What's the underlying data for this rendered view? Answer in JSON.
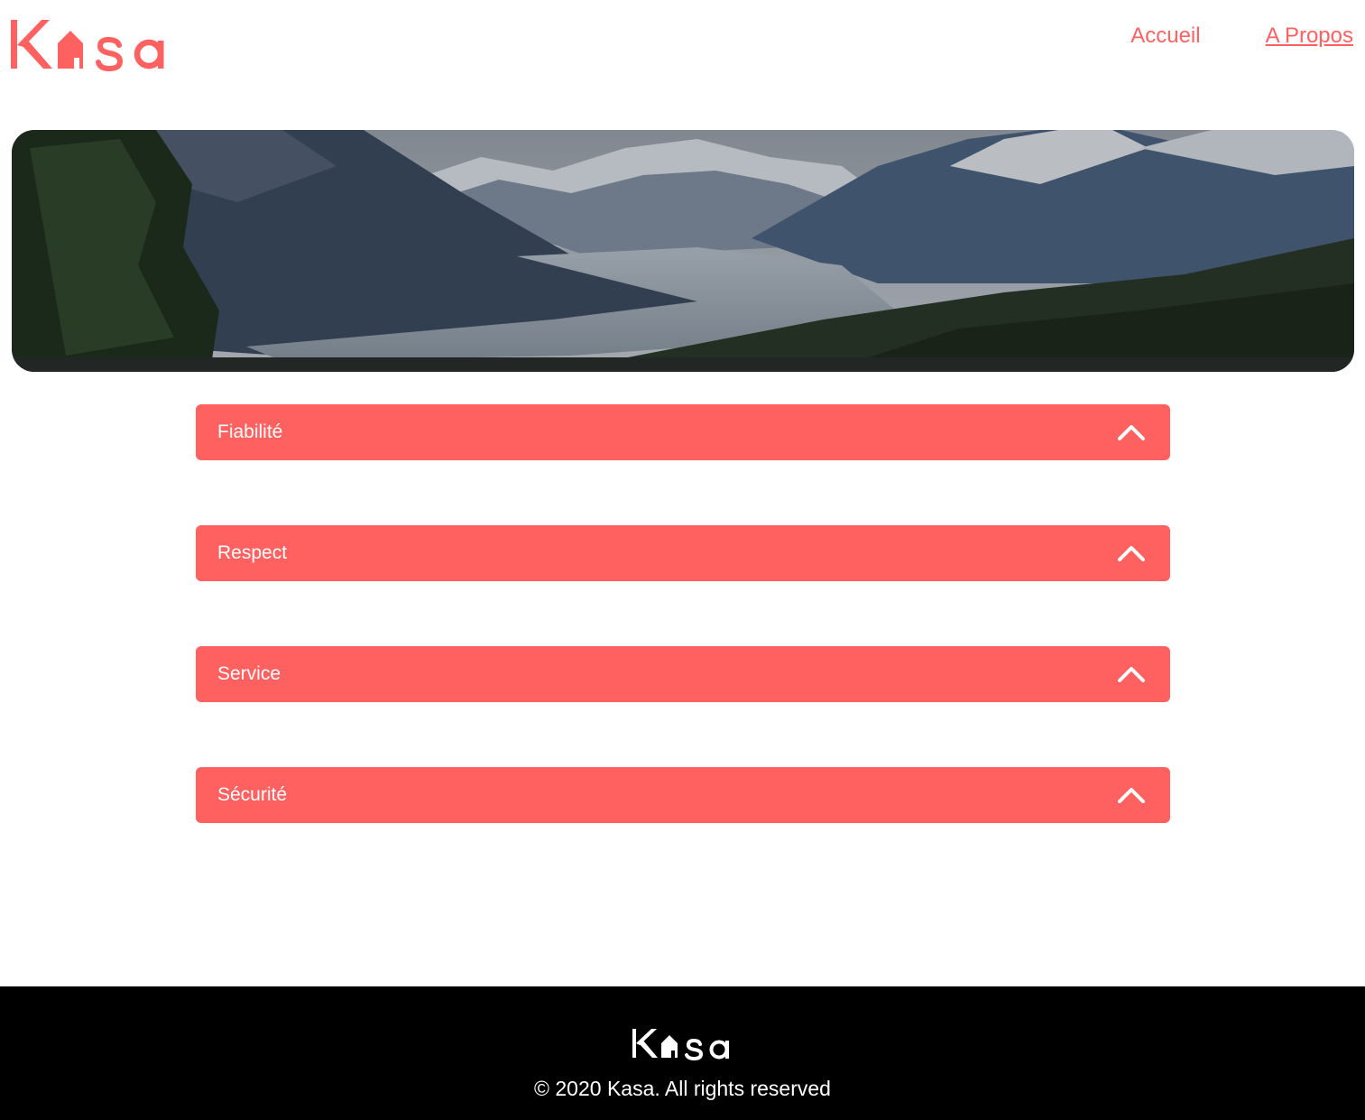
{
  "header": {
    "logo_text": "Kasa",
    "nav": [
      {
        "label": "Accueil",
        "active": false
      },
      {
        "label": "A Propos",
        "active": true
      }
    ]
  },
  "banner": {
    "image": "mountain-valley-landscape"
  },
  "collapses": [
    {
      "title": "Fiabilité",
      "icon": "chevron-up-icon"
    },
    {
      "title": "Respect",
      "icon": "chevron-up-icon"
    },
    {
      "title": "Service",
      "icon": "chevron-up-icon"
    },
    {
      "title": "Sécurité",
      "icon": "chevron-up-icon"
    }
  ],
  "footer": {
    "logo_text": "Kasa",
    "copyright": "© 2020 Kasa. All rights reserved"
  },
  "colors": {
    "brand": "#FF6060",
    "footer_bg": "#000000",
    "text_light": "#FFFFFF"
  }
}
